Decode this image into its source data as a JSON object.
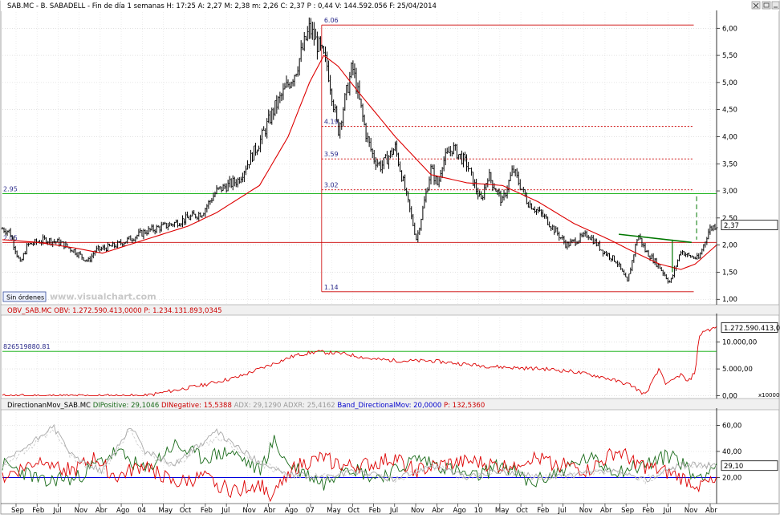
{
  "header": {
    "main": {
      "symbol": "SAB.MC - B. SABADELL",
      "fields": [
        "- Fin de día 1 semanas",
        "H: 17:25",
        "A: 2,27",
        "M: 2,38",
        "m: 2,26",
        "C: 2,37",
        "P : 0,44",
        "V: 144.592.056",
        "F: 25/04/2014"
      ]
    },
    "obv": [
      "OBV_SAB.MC",
      "OBV: 1.272.590.413,0000",
      "P: 1.234.131.893,0345"
    ],
    "dmi": [
      {
        "text": "DirectionanMov_SAB.MC",
        "color": "#000000"
      },
      {
        "text": "DIPositive: 29,1046",
        "color": "#1a6b1a"
      },
      {
        "text": "DINegative: 15,5388",
        "color": "#cc0000"
      },
      {
        "text": "ADX: 29,1290",
        "color": "#999999"
      },
      {
        "text": "ADXR: 25,4162",
        "color": "#999999"
      },
      {
        "text": "Band_DirectionalMov: 20,0000",
        "color": "#0000cc"
      },
      {
        "text": "P: 132,5360",
        "color": "#cc0000"
      }
    ]
  },
  "controls": {
    "orders_button": "Sin órdenes",
    "watermark": "www.visualchart.com",
    "scale_multiplier": "x100000"
  },
  "colors": {
    "price": "#000000",
    "moving_average": "#dd0000",
    "horizontal_support": "#00aa00",
    "fibonacci_levels": "#cc0000",
    "trendline": "#007700",
    "obv": "#dd0000",
    "di_positive": "#1a6b1a",
    "di_negative": "#dd0000",
    "adx": "#aaaaaa",
    "band": "#0000dd"
  },
  "chart_data": [
    {
      "type": "candlestick",
      "pane": "price",
      "symbol": "SAB.MC",
      "ylim": [
        0.9,
        6.3
      ],
      "y_ticks": [
        "6,00",
        "5,50",
        "5,00",
        "4,50",
        "4,00",
        "3,50",
        "3,00",
        "2,50",
        "2,00",
        "1,50",
        "1,00"
      ],
      "y_tick_values": [
        6.0,
        5.5,
        5.0,
        4.5,
        4.0,
        3.5,
        3.0,
        2.5,
        2.0,
        1.5,
        1.0
      ],
      "last_value_label": "2,37",
      "last_value": 2.37,
      "close_series": {
        "t": [
          0,
          0.01,
          0.025,
          0.035,
          0.06,
          0.08,
          0.1,
          0.12,
          0.13,
          0.16,
          0.2,
          0.24,
          0.28,
          0.3,
          0.33,
          0.36,
          0.38,
          0.41,
          0.43,
          0.445,
          0.455,
          0.47,
          0.49,
          0.51,
          0.52,
          0.53,
          0.55,
          0.58,
          0.6,
          0.61,
          0.615,
          0.63,
          0.65,
          0.67,
          0.68,
          0.7,
          0.715,
          0.735,
          0.76,
          0.79,
          0.82,
          0.84,
          0.86,
          0.875,
          0.89,
          0.9,
          0.92,
          0.935,
          0.95,
          0.96,
          0.975,
          0.99,
          1.0
        ],
        "v": [
          2.3,
          2.25,
          1.65,
          2.0,
          2.1,
          2.05,
          1.9,
          1.7,
          1.9,
          2.0,
          2.25,
          2.4,
          2.6,
          3.0,
          3.2,
          3.9,
          4.5,
          5.2,
          6.0,
          5.6,
          5.3,
          4.1,
          5.3,
          4.0,
          3.6,
          3.45,
          3.8,
          2.1,
          3.4,
          3.1,
          3.5,
          3.8,
          3.5,
          2.8,
          3.3,
          2.8,
          3.4,
          2.8,
          2.5,
          2.0,
          2.2,
          1.9,
          1.7,
          1.3,
          2.2,
          1.9,
          1.6,
          1.3,
          1.9,
          1.8,
          1.75,
          2.3,
          2.37
        ]
      },
      "moving_average": {
        "t": [
          0,
          0.05,
          0.1,
          0.14,
          0.2,
          0.26,
          0.3,
          0.36,
          0.4,
          0.43,
          0.45,
          0.47,
          0.5,
          0.55,
          0.6,
          0.65,
          0.7,
          0.75,
          0.8,
          0.85,
          0.88,
          0.92,
          0.95,
          0.97,
          1.0
        ],
        "v": [
          2.1,
          2.05,
          1.95,
          1.85,
          2.1,
          2.35,
          2.6,
          3.1,
          4.0,
          5.0,
          5.5,
          5.3,
          4.8,
          4.0,
          3.3,
          3.15,
          3.1,
          2.8,
          2.4,
          2.1,
          1.9,
          1.65,
          1.55,
          1.65,
          2.0
        ]
      },
      "horizontal_lines": [
        {
          "value": 2.95,
          "label": "2.95",
          "color": "#00aa00"
        },
        {
          "value": 2.05,
          "label": "2.05",
          "color": "#cc0000"
        }
      ],
      "fibonacci": {
        "levels": [
          {
            "value": 6.06,
            "label": "6.06",
            "style": "solid"
          },
          {
            "value": 4.19,
            "label": "4.19",
            "style": "dotted"
          },
          {
            "value": 3.59,
            "label": "3.59",
            "style": "dotted"
          },
          {
            "value": 3.02,
            "label": "3.02",
            "style": "dotted"
          },
          {
            "value": 1.14,
            "label": "1.14",
            "style": "solid"
          }
        ]
      },
      "trendline": {
        "from": [
          0.863,
          2.2
        ],
        "to": [
          0.965,
          2.05
        ]
      }
    },
    {
      "type": "line",
      "pane": "obv",
      "name": "OBV_SAB.MC",
      "ylim": [
        -0.5,
        15.0
      ],
      "y_ticks": [
        "10.000,00",
        "5.000,00",
        "0,00"
      ],
      "y_tick_values": [
        10,
        5,
        0
      ],
      "last_value_label": "1.272.590.413,0",
      "level": {
        "value": 8.265,
        "label": "826519880.81"
      },
      "t": [
        0,
        0.1,
        0.2,
        0.22,
        0.28,
        0.33,
        0.37,
        0.41,
        0.44,
        0.48,
        0.52,
        0.56,
        0.6,
        0.64,
        0.68,
        0.72,
        0.76,
        0.8,
        0.84,
        0.88,
        0.9,
        0.92,
        0.93,
        0.95,
        0.96,
        0.97,
        0.975,
        0.98,
        0.99,
        1.0
      ],
      "v": [
        0.0,
        0.0,
        0.0,
        0.5,
        2.0,
        3.5,
        5.5,
        7.5,
        8.2,
        7.8,
        6.8,
        6.5,
        6.5,
        6.0,
        5.5,
        5.2,
        5.0,
        4.5,
        3.5,
        2.0,
        0.2,
        5.0,
        2.0,
        4.0,
        2.5,
        4.5,
        10.5,
        12.0,
        12.3,
        12.7
      ]
    },
    {
      "type": "line",
      "pane": "directional_movement",
      "name": "DirectionanMov_SAB.MC",
      "ylim": [
        0,
        72
      ],
      "y_ticks": [
        "60,00",
        "40,00",
        "20,00"
      ],
      "y_tick_values": [
        60,
        40,
        20
      ],
      "last_value_label": "29,10",
      "band": 20,
      "series": [
        {
          "name": "DIPositive",
          "color": "#1a6b1a",
          "t": [
            0,
            0.04,
            0.06,
            0.08,
            0.1,
            0.13,
            0.16,
            0.2,
            0.24,
            0.28,
            0.32,
            0.36,
            0.38,
            0.4,
            0.42,
            0.45,
            0.48,
            0.52,
            0.55,
            0.58,
            0.62,
            0.66,
            0.7,
            0.74,
            0.78,
            0.82,
            0.86,
            0.9,
            0.94,
            0.97,
            1.0
          ],
          "v": [
            30,
            22,
            15,
            20,
            18,
            30,
            40,
            25,
            45,
            35,
            40,
            25,
            48,
            30,
            25,
            15,
            30,
            20,
            25,
            35,
            28,
            20,
            30,
            15,
            25,
            35,
            25,
            30,
            38,
            20,
            29
          ]
        },
        {
          "name": "DINegative",
          "color": "#dd0000",
          "t": [
            0,
            0.04,
            0.06,
            0.08,
            0.1,
            0.13,
            0.16,
            0.2,
            0.24,
            0.28,
            0.32,
            0.36,
            0.38,
            0.4,
            0.42,
            0.45,
            0.48,
            0.52,
            0.55,
            0.58,
            0.62,
            0.66,
            0.7,
            0.74,
            0.78,
            0.82,
            0.86,
            0.9,
            0.94,
            0.97,
            1.0
          ],
          "v": [
            20,
            30,
            35,
            28,
            25,
            35,
            20,
            30,
            15,
            20,
            10,
            15,
            5,
            25,
            30,
            35,
            28,
            30,
            35,
            25,
            30,
            32,
            28,
            35,
            30,
            25,
            40,
            28,
            22,
            15,
            15
          ]
        },
        {
          "name": "ADX",
          "color": "#aaaaaa",
          "t": [
            0,
            0.05,
            0.07,
            0.1,
            0.14,
            0.18,
            0.2,
            0.24,
            0.3,
            0.35,
            0.4,
            0.45,
            0.5,
            0.55,
            0.6,
            0.65,
            0.7,
            0.75,
            0.8,
            0.85,
            0.9,
            0.95,
            1.0
          ],
          "v": [
            30,
            50,
            60,
            35,
            25,
            60,
            40,
            30,
            55,
            35,
            22,
            20,
            25,
            18,
            30,
            20,
            25,
            20,
            22,
            25,
            18,
            30,
            29
          ]
        }
      ]
    }
  ],
  "x_axis_labels": [
    "Sep",
    "Feb",
    "Jul",
    "Nov",
    "Abr",
    "Ago",
    "04",
    "May",
    "Oct",
    "Feb",
    "Jul",
    "Nov",
    "Abr",
    "Ago",
    "07",
    "May",
    "Oct",
    "Feb",
    "Jul",
    "Nov",
    "Abr",
    "Ago",
    "10",
    "May",
    "Oct",
    "Feb",
    "Jul",
    "Nov",
    "Abr",
    "Sep",
    "Feb",
    "Jul",
    "Nov",
    "Abr"
  ]
}
